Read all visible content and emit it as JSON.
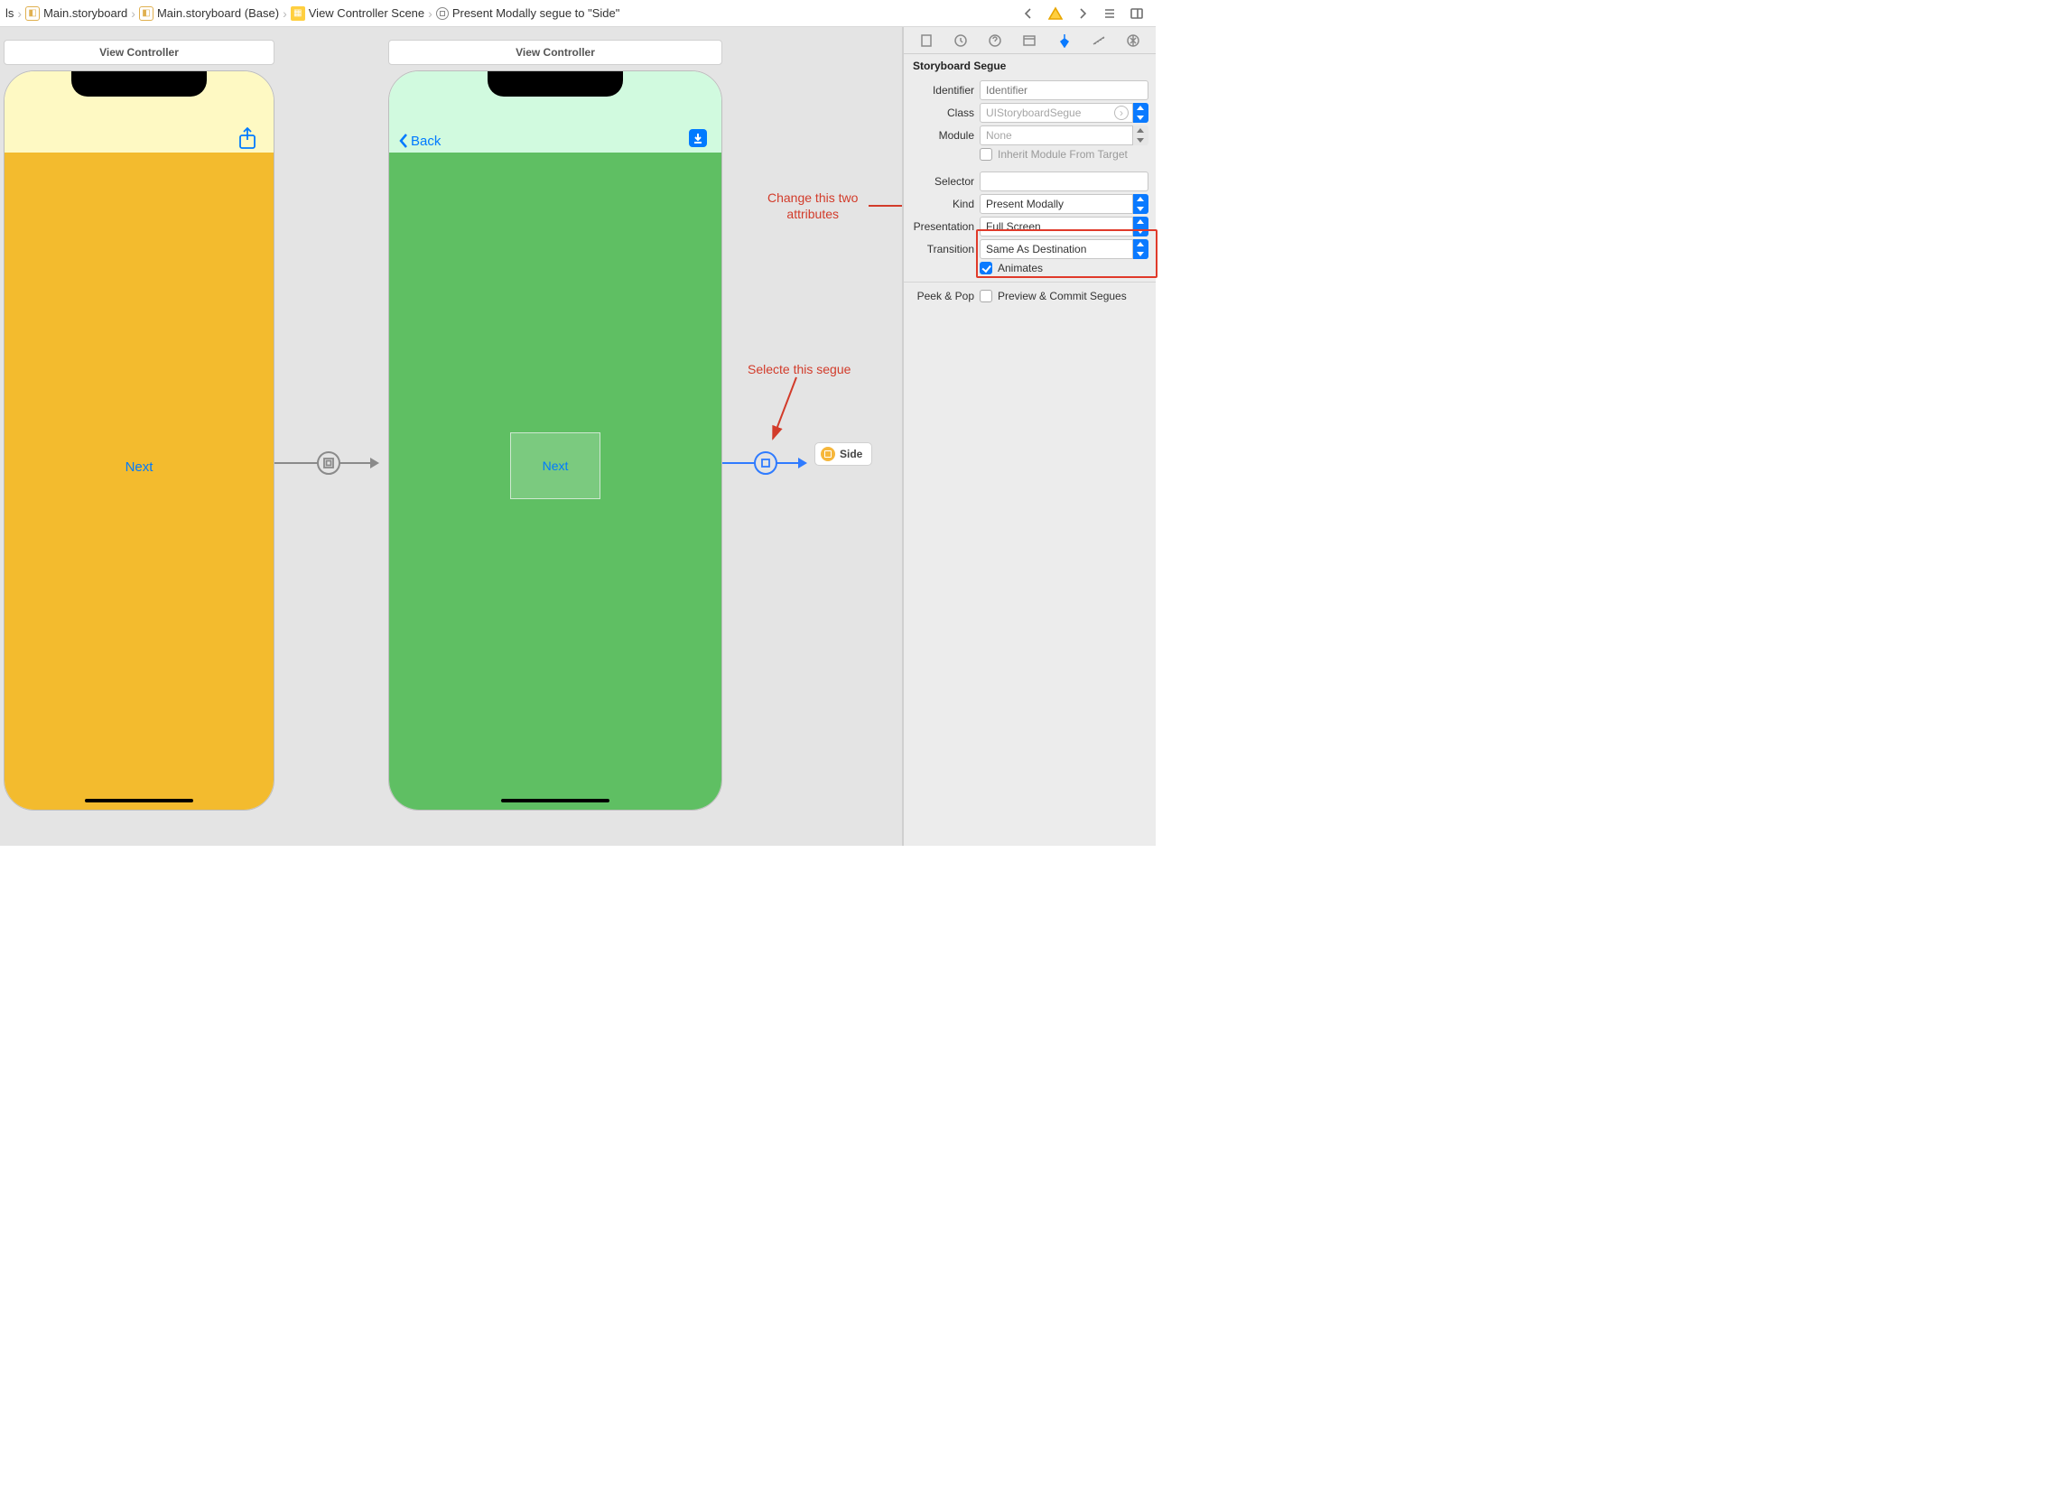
{
  "breadcrumbs": {
    "b0": "ls",
    "b1": "Main.storyboard",
    "b2": "Main.storyboard (Base)",
    "b3": "View Controller Scene",
    "b4": "Present Modally segue to \"Side\""
  },
  "scenes": {
    "s1_title": "View Controller",
    "s1_next": "Next",
    "s2_title": "View Controller",
    "s2_back": "Back",
    "s2_next": "Next",
    "ref_label": "Side"
  },
  "annotations": {
    "change": "Change this two\nattributes",
    "select": "Selecte this segue"
  },
  "inspector": {
    "section": "Storyboard Segue",
    "identifier_label": "Identifier",
    "identifier_placeholder": "Identifier",
    "class_label": "Class",
    "class_value": "UIStoryboardSegue",
    "module_label": "Module",
    "module_value": "None",
    "inherit_label": "Inherit Module From Target",
    "selector_label": "Selector",
    "selector_value": "",
    "kind_label": "Kind",
    "kind_value": "Present Modally",
    "presentation_label": "Presentation",
    "presentation_value": "Full Screen",
    "transition_label": "Transition",
    "transition_value": "Same As Destination",
    "animates_label": "Animates",
    "peek_label": "Peek & Pop",
    "peek_value": "Preview & Commit Segues"
  }
}
